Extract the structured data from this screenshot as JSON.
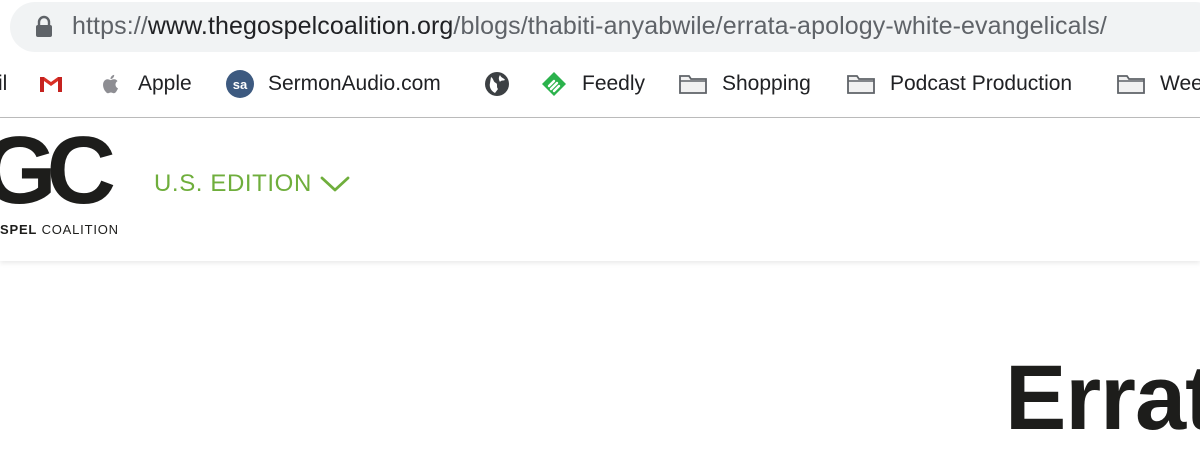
{
  "browser": {
    "url": {
      "scheme": "https://",
      "host": "www.thegospelcoalition.org",
      "path": "/blogs/thabiti-anyabwile/errata-apology-white-evangelicals/"
    },
    "bookmarks": [
      {
        "label": "il",
        "icon": "gmail-label-fragment"
      },
      {
        "label": "",
        "icon": "gmail-icon"
      },
      {
        "label": "Apple",
        "icon": "apple-icon"
      },
      {
        "label": "SermonAudio.com",
        "icon": "sermonaudio-icon"
      },
      {
        "label": "",
        "icon": "globe-icon"
      },
      {
        "label": "Feedly",
        "icon": "feedly-icon"
      },
      {
        "label": "Shopping",
        "icon": "folder-icon"
      },
      {
        "label": "Podcast Production",
        "icon": "folder-icon"
      },
      {
        "label": "Wee",
        "icon": "folder-icon"
      }
    ]
  },
  "site": {
    "logo_letters": "GC",
    "logo_sub_bold": "SPEL",
    "logo_sub_rest": " COALITION",
    "edition_label": "U.S. EDITION",
    "colors": {
      "accent": "#6fae3c",
      "text": "#1d1d1b"
    }
  },
  "article": {
    "title_visible": "Errat"
  }
}
